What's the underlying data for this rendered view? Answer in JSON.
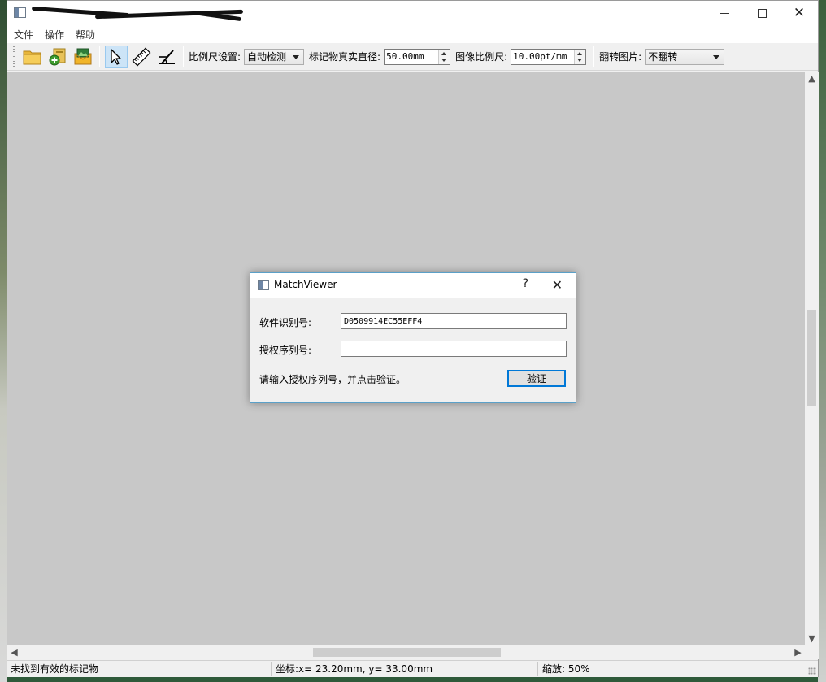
{
  "window": {
    "title": "",
    "controls": {
      "minimize": "—",
      "maximize": "☐",
      "close": "✕"
    }
  },
  "menu": {
    "items": [
      "文件",
      "操作",
      "帮助"
    ]
  },
  "toolbar": {
    "icons": [
      "open-folder-icon",
      "add-folder-icon",
      "save-image-icon",
      "pointer-icon",
      "ruler-icon",
      "angle-icon"
    ],
    "scale_setting_label": "比例尺设置:",
    "scale_setting_value": "自动检测",
    "marker_diameter_label": "标记物真实直径:",
    "marker_diameter_value": "50.00mm",
    "image_scale_label": "图像比例尺:",
    "image_scale_value": "10.00pt/mm",
    "flip_label": "翻转图片:",
    "flip_value": "不翻转"
  },
  "status": {
    "message": "未找到有效的标记物",
    "coords": "坐标:x= 23.20mm, y= 33.00mm",
    "zoom": "缩放:  50%"
  },
  "dialog": {
    "title": "MatchViewer",
    "help": "?",
    "close": "✕",
    "software_id_label": "软件识别号:",
    "software_id_value": "D0509914EC55EFF4",
    "serial_label": "授权序列号:",
    "serial_value": "",
    "hint": "请输入授权序列号，并点击验证。",
    "verify_button": "验证"
  },
  "colors": {
    "canvas": "#c8c8c8",
    "dialog_border": "#5aa0c8",
    "focus_blue": "#0078d7",
    "active_tool": "#cce4f7"
  }
}
